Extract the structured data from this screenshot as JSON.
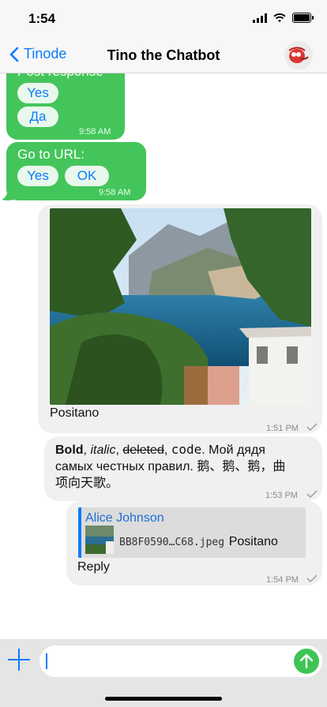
{
  "status": {
    "time": "1:54"
  },
  "nav": {
    "back_label": "Tinode",
    "title": "Tino the Chatbot"
  },
  "messages": {
    "m1": {
      "header": "Post response",
      "buttons": [
        "Yes",
        "Да"
      ],
      "time": "9:58 AM"
    },
    "m2": {
      "header": "Go to URL:",
      "buttons": [
        "Yes",
        "OK"
      ],
      "time": "9:58 AM"
    },
    "m3": {
      "caption": "Positano",
      "time": "1:51 PM"
    },
    "m4": {
      "bold": "Bold",
      "sep1": ", ",
      "italic": "italic",
      "sep2": ", ",
      "deleted": "deleted",
      "sep3": ", ",
      "code": "code",
      "rest_line1": ". Мой дядя",
      "line2": "самых честных правил. 鹅、鹅、鹅，曲",
      "line3": "项向天歌。",
      "time": "1:53 PM"
    },
    "m5": {
      "quote_author": "Alice Johnson",
      "quote_file": "BB8F0590…C68.jpeg",
      "quote_text": "Positano",
      "reply": "Reply",
      "time": "1:54 PM"
    }
  },
  "composer": {
    "placeholder": ""
  },
  "colors": {
    "accent": "#0a7aff",
    "incoming": "#44c55b",
    "outgoing": "#f0f0f0",
    "send": "#3ec455"
  }
}
